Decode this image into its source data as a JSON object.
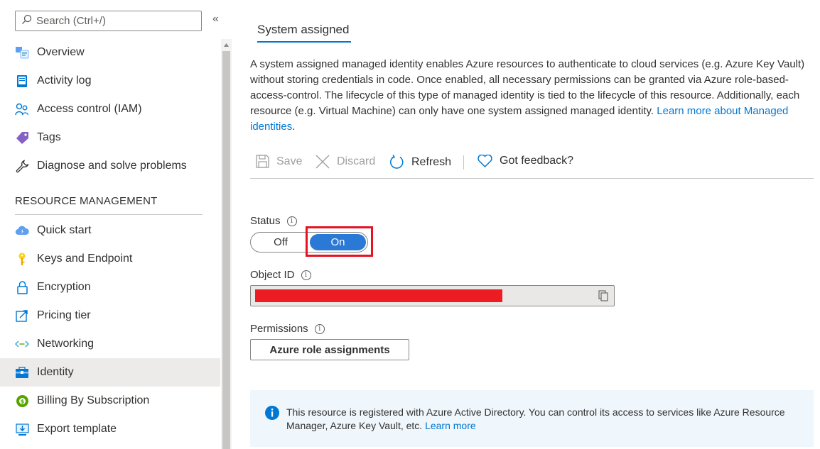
{
  "sidebar": {
    "search_placeholder": "Search (Ctrl+/)",
    "collapse_glyph": "«",
    "items_top": [
      {
        "label": "Overview",
        "icon": "overview-icon"
      },
      {
        "label": "Activity log",
        "icon": "activity-log-icon"
      },
      {
        "label": "Access control (IAM)",
        "icon": "iam-icon"
      },
      {
        "label": "Tags",
        "icon": "tag-icon"
      },
      {
        "label": "Diagnose and solve problems",
        "icon": "wrench-icon"
      }
    ],
    "section_header": "RESOURCE MANAGEMENT",
    "items_rm": [
      {
        "label": "Quick start",
        "icon": "cloud-icon"
      },
      {
        "label": "Keys and Endpoint",
        "icon": "key-icon"
      },
      {
        "label": "Encryption",
        "icon": "lock-icon"
      },
      {
        "label": "Pricing tier",
        "icon": "pricing-icon"
      },
      {
        "label": "Networking",
        "icon": "network-icon"
      },
      {
        "label": "Identity",
        "icon": "identity-icon",
        "selected": true
      },
      {
        "label": "Billing By Subscription",
        "icon": "billing-icon"
      },
      {
        "label": "Export template",
        "icon": "export-icon"
      }
    ]
  },
  "main": {
    "tab_label": "System assigned",
    "description": "A system assigned managed identity enables Azure resources to authenticate to cloud services (e.g. Azure Key Vault) without storing credentials in code. Once enabled, all necessary permissions can be granted via Azure role-based-access-control. The lifecycle of this type of managed identity is tied to the lifecycle of this resource. Additionally, each resource (e.g. Virtual Machine) can only have one system assigned managed identity. ",
    "description_link": "Learn more about Managed identities",
    "description_end": ".",
    "toolbar": {
      "save": "Save",
      "discard": "Discard",
      "refresh": "Refresh",
      "feedback": "Got feedback?"
    },
    "status_label": "Status",
    "toggle_off": "Off",
    "toggle_on": "On",
    "toggle_value": "On",
    "object_id_label": "Object ID",
    "permissions_label": "Permissions",
    "permissions_button": "Azure role assignments",
    "info_text": "This resource is registered with Azure Active Directory. You can control its access to services like Azure Resource Manager, Azure Key Vault, etc. ",
    "info_link": "Learn more",
    "info_glyph": "i"
  },
  "colors": {
    "accent": "#0078d4",
    "toggle_on": "#2b79d6",
    "highlight": "#e81123",
    "redaction": "#ec1c24",
    "info_bg": "#eff6fc",
    "selected_bg": "#edebe9"
  }
}
